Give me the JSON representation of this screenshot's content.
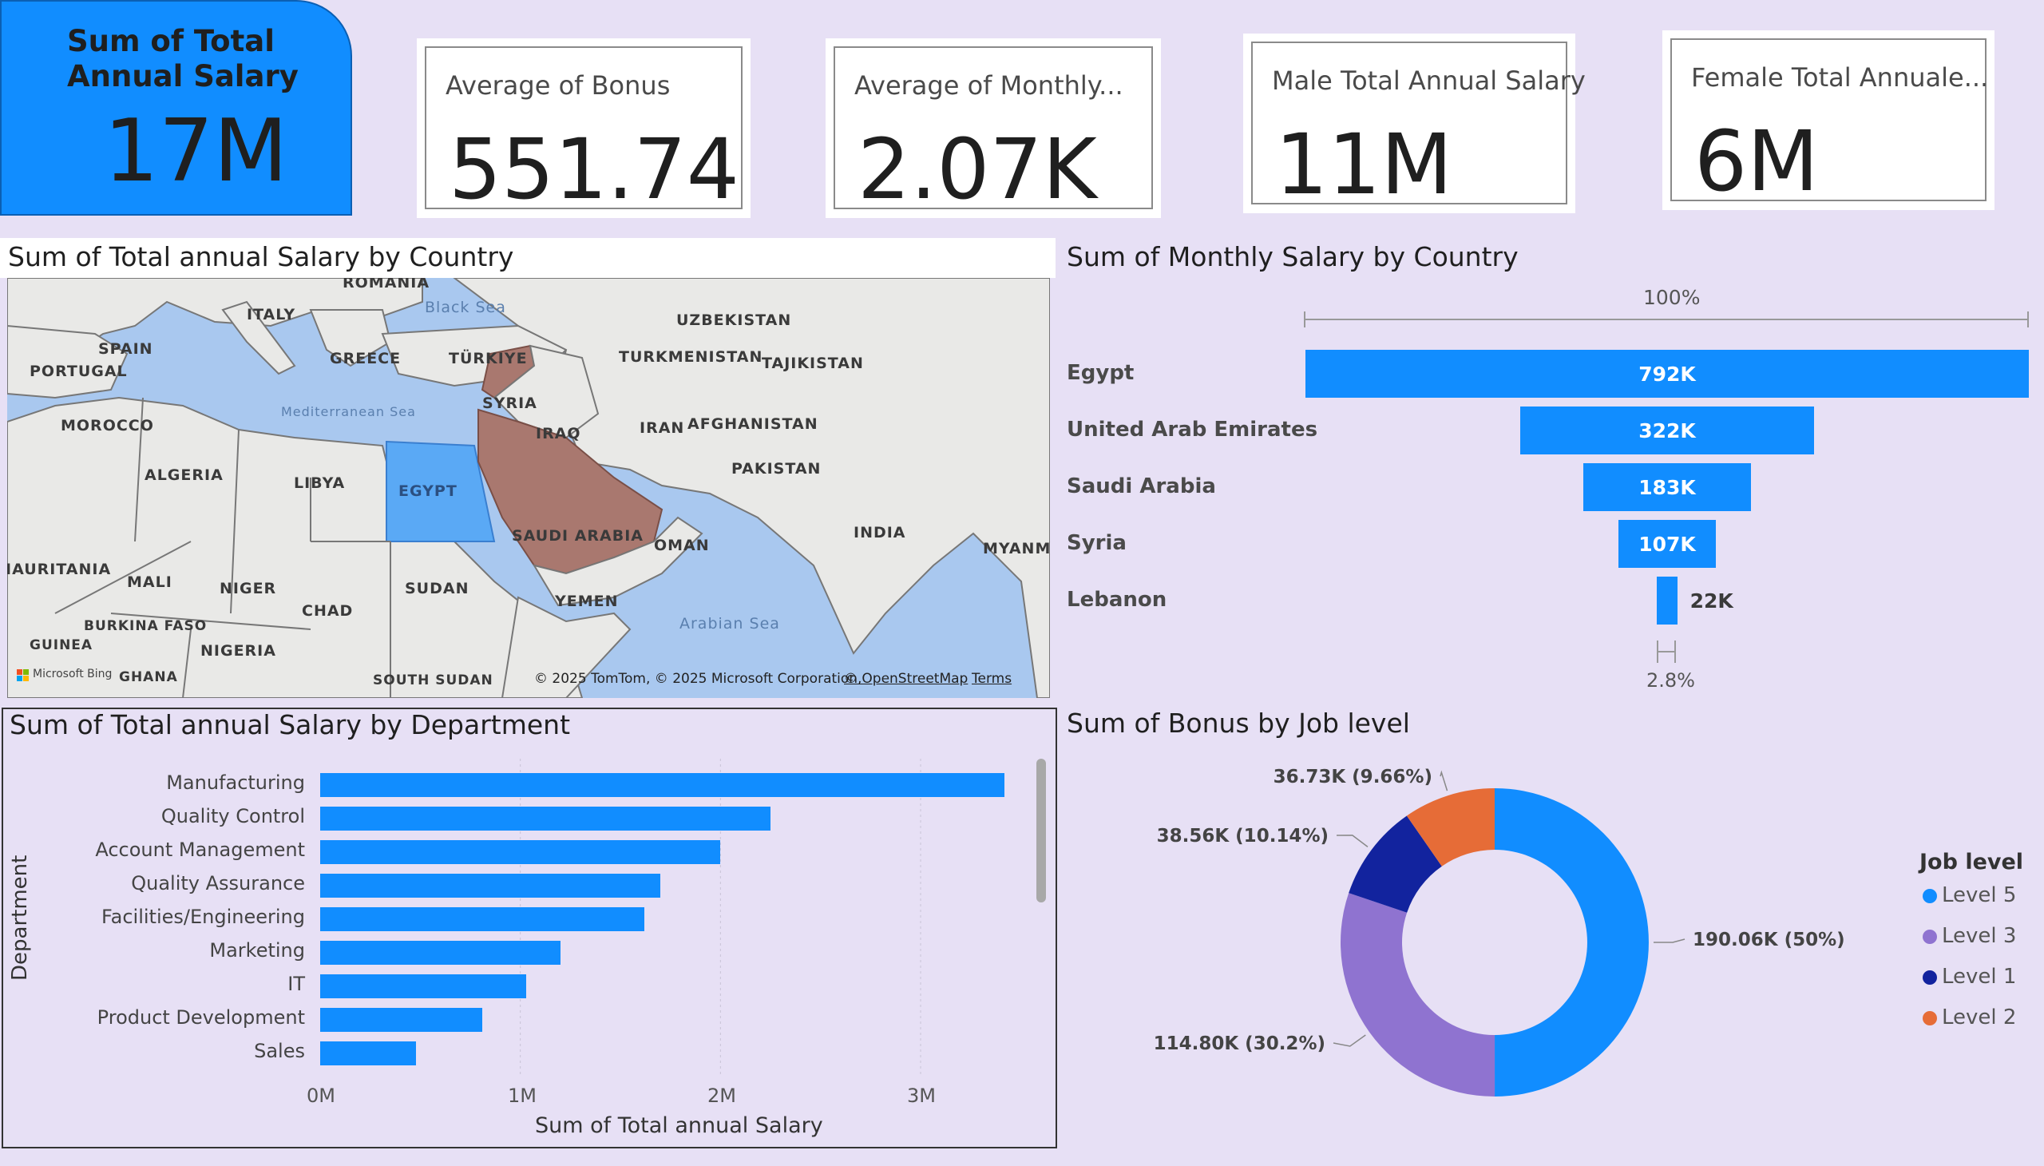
{
  "kpis": {
    "total_salary": {
      "title": "Sum of Total Annual Salary",
      "value": "17M"
    },
    "avg_bonus": {
      "title": "Average of Bonus",
      "value": "551.74"
    },
    "avg_monthly": {
      "title": "Average of Monthly...",
      "value": "2.07K"
    },
    "male_total": {
      "title": "Male Total Annual Salary",
      "value": "11M"
    },
    "female_total": {
      "title": "Female Total Annuale...",
      "value": "6M"
    }
  },
  "map": {
    "title": "Sum of Total annual Salary by Country",
    "labels": {
      "romania": "ROMANIA",
      "italy": "ITALY",
      "spain": "SPAIN",
      "portugal": "PORTUGAL",
      "greece": "GREECE",
      "turkiye": "TÜRKIYE",
      "uzbekistan": "UZBEKISTAN",
      "turkmenistan": "TURKMENISTAN",
      "tajikistan": "TAJIKISTAN",
      "syria": "SYRIA",
      "morocco": "MOROCCO",
      "iraq": "IRAQ",
      "iran": "IRAN",
      "afghanistan": "AFGHANISTAN",
      "algeria": "ALGERIA",
      "libya": "LIBYA",
      "egypt": "EGYPT",
      "pakistan": "PAKISTAN",
      "saudi": "SAUDI ARABIA",
      "oman": "OMAN",
      "india": "INDIA",
      "mauritania": "IAURITANIA",
      "mali": "MALI",
      "niger": "NIGER",
      "sudan": "SUDAN",
      "myanmar": "MYANM",
      "chad": "CHAD",
      "yemen": "YEMEN",
      "burkina": "BURKINA FASO",
      "nigeria": "NIGERIA",
      "guinea": "GUINEA",
      "ghana": "GHANA",
      "south_sudan": "SOUTH SUDAN",
      "black_sea": "Black Sea",
      "med_sea": "Mediterranean Sea",
      "arabian_sea": "Arabian Sea"
    },
    "brand": "Microsoft Bing",
    "credit": "© 2025 TomTom, © 2025 Microsoft Corporation,",
    "credit_link": "© OpenStreetMap",
    "terms": "Terms",
    "colors": {
      "egypt": "#5aa9f5",
      "highlight": "#a9786f",
      "water": "#a9c8ef",
      "land": "#e9e9e7"
    }
  },
  "funnel": {
    "title": "Sum of Monthly Salary by Country",
    "top_pct": "100%",
    "bottom_pct": "2.8%"
  },
  "department": {
    "title": "Sum of Total annual Salary by Department",
    "ylabel": "Department",
    "xlabel": "Sum of Total annual Salary",
    "ticks": [
      "0M",
      "1M",
      "2M",
      "3M"
    ]
  },
  "donut": {
    "title": "Sum of Bonus by Job level",
    "legend_title": "Job level"
  },
  "chart_data": [
    {
      "type": "bar",
      "title": "Sum of Monthly Salary by Country",
      "categories": [
        "Egypt",
        "United Arab Emirates",
        "Saudi Arabia",
        "Syria",
        "Lebanon"
      ],
      "values": [
        792000,
        322000,
        183000,
        107000,
        22000
      ],
      "labels": [
        "792K",
        "322K",
        "183K",
        "107K",
        "22K"
      ],
      "color": "#118dff"
    },
    {
      "type": "bar",
      "title": "Sum of Total annual Salary by Department",
      "categories": [
        "Manufacturing",
        "Quality Control",
        "Account Management",
        "Quality Assurance",
        "Facilities/Engineering",
        "Marketing",
        "IT",
        "Product Development",
        "Sales"
      ],
      "values": [
        3420000,
        2250000,
        2000000,
        1700000,
        1620000,
        1200000,
        1030000,
        810000,
        480000
      ],
      "xlabel": "Sum of Total annual Salary",
      "ylabel": "Department",
      "xlim": [
        0,
        3500000
      ],
      "color": "#118dff"
    },
    {
      "type": "pie",
      "title": "Sum of Bonus by Job level",
      "categories": [
        "Level 5",
        "Level 3",
        "Level 1",
        "Level 2"
      ],
      "values": [
        190060,
        114800,
        38560,
        36730
      ],
      "labels": [
        "190.06K (50%)",
        "114.80K (30.2%)",
        "38.56K (10.14%)",
        "36.73K (9.66%)"
      ],
      "colors": [
        "#118dff",
        "#8f73d0",
        "#12239e",
        "#e66c37"
      ],
      "legend": "right"
    }
  ]
}
